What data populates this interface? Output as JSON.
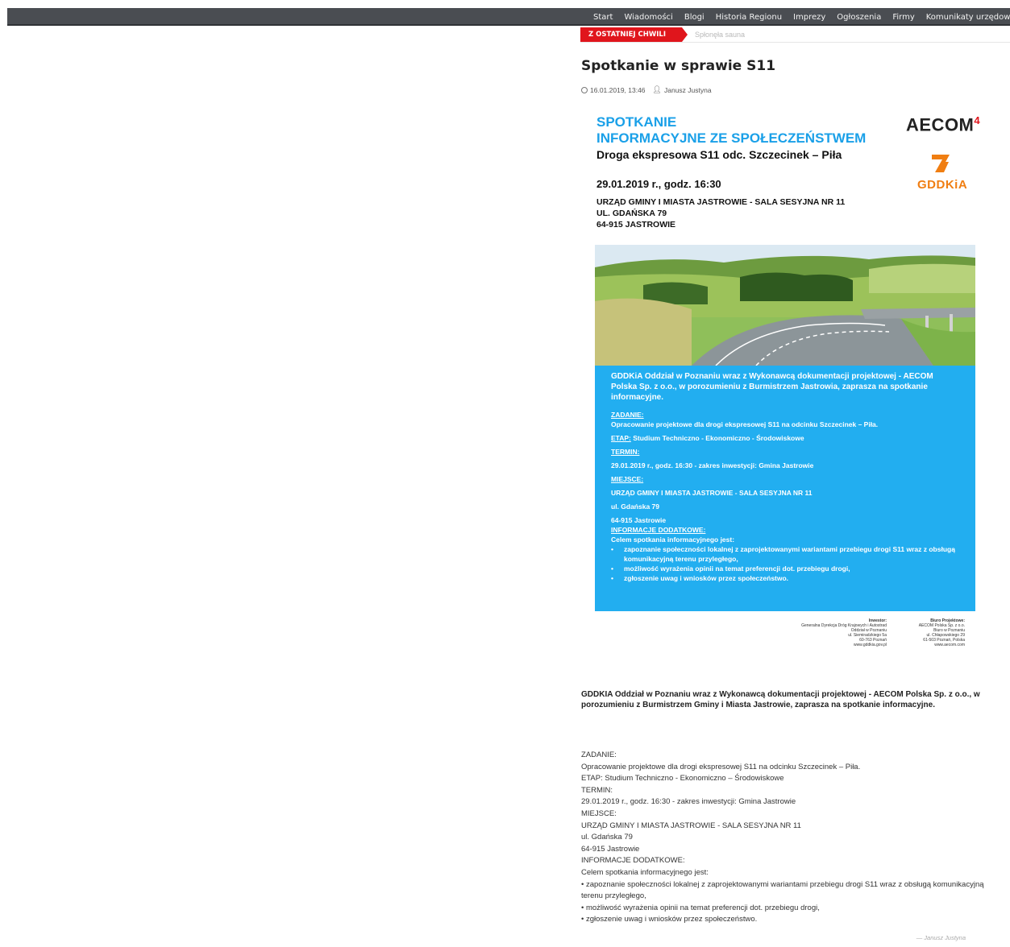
{
  "nav": {
    "items": [
      "Start",
      "Wiadomości",
      "Blogi",
      "Historia Regionu",
      "Imprezy",
      "Ogłoszenia",
      "Firmy",
      "Komunikaty urzędowe"
    ]
  },
  "ticker": {
    "label": "Z OSTATNIEJ CHWILI",
    "text": "Spłonęła sauna"
  },
  "article": {
    "title": "Spotkanie w sprawie S11",
    "date": "16.01.2019, 13:46",
    "author": "Janusz Justyna",
    "signature": "— Janusz Justyna"
  },
  "poster": {
    "heading1": "SPOTKANIE",
    "heading2": "INFORMACYJNE ZE SPOŁECZEŃSTWEM",
    "heading3": "Droga ekspresowa S11 odc. Szczecinek – Piła",
    "date": "29.01.2019 r., godz. 16:30",
    "address": [
      "URZĄD GMINY I MIASTA JASTROWIE - SALA SESYJNA NR 11",
      "UL. GDAŃSKA 79",
      "64-915 JASTROWIE"
    ],
    "logo_aecom": "AECOM",
    "logo_aecom_mark": "4",
    "logo_gddkia": "GDDKiA",
    "blue": {
      "intro": "GDDKiA Oddział w Poznaniu wraz z Wykonawcą dokumentacji projektowej - AECOM Polska Sp. z o.o., w porozumieniu z Burmistrzem Jastrowia, zaprasza na spotkanie informacyjne.",
      "zadanie_label": "ZADANIE:",
      "zadanie": "Opracowanie projektowe dla drogi ekspresowej S11 na odcinku Szczecinek – Piła.",
      "etap_label": "ETAP:",
      "etap": " Studium Techniczno - Ekonomiczno - Środowiskowe",
      "termin_label": "TERMIN:",
      "termin": "29.01.2019 r., godz. 16:30 - zakres inwestycji: Gmina Jastrowie",
      "miejsce_label": "MIEJSCE:",
      "miejsce": [
        "URZĄD GMINY I MIASTA JASTROWIE - SALA SESYJNA NR 11",
        "ul. Gdańska 79",
        "64-915 Jastrowie"
      ],
      "info_label": "INFORMACJE DODATKOWE:",
      "info_intro": "Celem spotkania informacyjnego jest:",
      "bullets": [
        "zapoznanie społeczności lokalnej z zaprojektowanymi wariantami przebiegu drogi S11 wraz z obsługą komunikacyjną terenu przyległego,",
        "możliwość wyrażenia opinii na temat preferencji dot. przebiegu drogi,",
        "zgłoszenie uwag i wniosków przez społeczeństwo."
      ]
    },
    "footer": {
      "investor_label": "Inwestor:",
      "investor": [
        "Generalna Dyrekcja Dróg Krajowych i Autostrad",
        "Oddział w Poznaniu",
        "ul. Siemiradzkiego 5a",
        "60-763 Poznań",
        "www.gddkia.gov.pl"
      ],
      "biuro_label": "Biuro Projektowe:",
      "biuro": [
        "AECOM Polska Sp. z o.o.",
        "Biuro w Poznaniu",
        "ul. Chłapowskiego 29",
        "61-503 Poznań, Polska",
        "www.aecom.com"
      ]
    }
  },
  "body": {
    "lead": "GDDKIA Oddział w Poznaniu wraz z Wykonawcą dokumentacji projektowej - AECOM Polska Sp. z o.o., w porozumieniu z Burmistrzem Gminy i Miasta Jastrowie, zaprasza na spotkanie informacyjne.",
    "lines": [
      "ZADANIE:",
      "Opracowanie projektowe dla drogi ekspresowej S11 na odcinku Szczecinek – Piła.",
      "ETAP: Studium Techniczno - Ekonomiczno – Środowiskowe",
      "TERMIN:",
      "29.01.2019 r., godz. 16:30 - zakres inwestycji: Gmina Jastrowie",
      "MIEJSCE:",
      "URZĄD GMINY I MIASTA JASTROWIE - SALA SESYJNA NR 11",
      "ul. Gdańska 79",
      "64-915 Jastrowie",
      "INFORMACJE DODATKOWE:",
      "Celem spotkania informacyjnego jest:"
    ],
    "bullets": [
      "• zapoznanie społeczności lokalnej z zaprojektowanymi wariantami przebiegu drogi S11 wraz z obsługą komunikacyjną terenu przyległego,",
      "• możliwość wyrażenia opinii na temat preferencji dot. przebiegu drogi,",
      "• zgłoszenie uwag i wniosków przez społeczeństwo."
    ]
  }
}
